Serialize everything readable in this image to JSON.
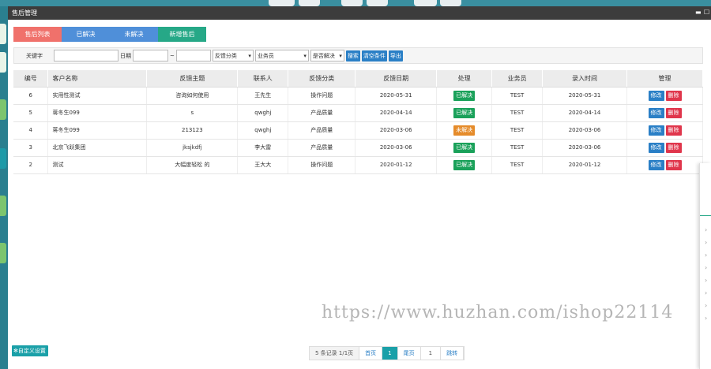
{
  "window": {
    "title": "售后管理"
  },
  "tabs": [
    {
      "label": "售后列表"
    },
    {
      "label": "已解决"
    },
    {
      "label": "未解决"
    },
    {
      "label": "新增售后"
    }
  ],
  "toolbar": {
    "keyword_label": "关键字",
    "date_label": "日期",
    "date_sep": "~",
    "feedback_select": "反馈分类",
    "salesman_select": "业务员",
    "resolved_select": "是否解决",
    "search_btn": "搜索",
    "clear_btn": "清空条件",
    "export_btn": "导出"
  },
  "table": {
    "headers": [
      "编号",
      "客户名称",
      "反馈主题",
      "联系人",
      "反馈分类",
      "反馈日期",
      "处理",
      "业务员",
      "录入时间",
      "管理"
    ],
    "rows": [
      {
        "id": "6",
        "customer": "实用性测试",
        "topic": "咨询如何使用",
        "contact": "王先生",
        "category": "操作问题",
        "date": "2020-05-31",
        "status": "已解决",
        "salesman": "TEST",
        "entry": "2020-05-31"
      },
      {
        "id": "5",
        "customer": "蒋冬生099",
        "topic": "s",
        "contact": "qwghj",
        "category": "产品质量",
        "date": "2020-04-14",
        "status": "已解决",
        "salesman": "TEST",
        "entry": "2020-04-14"
      },
      {
        "id": "4",
        "customer": "蒋冬生099",
        "topic": "213123",
        "contact": "qwghj",
        "category": "产品质量",
        "date": "2020-03-06",
        "status": "未解决",
        "salesman": "TEST",
        "entry": "2020-03-06"
      },
      {
        "id": "3",
        "customer": "北京飞跃集团",
        "topic": "jksjkdfj",
        "contact": "李大雷",
        "category": "产品质量",
        "date": "2020-03-06",
        "status": "已解决",
        "salesman": "TEST",
        "entry": "2020-03-06"
      },
      {
        "id": "2",
        "customer": "测试",
        "topic": "大幅度轻松 的",
        "contact": "王大大",
        "category": "操作问题",
        "date": "2020-01-12",
        "status": "已解决",
        "salesman": "TEST",
        "entry": "2020-01-12"
      }
    ],
    "edit_label": "修改",
    "delete_label": "删除"
  },
  "footer": {
    "custom_settings": "自定义设置",
    "page_info": "5 条记录 1/1页",
    "first": "首页",
    "current": "1",
    "last": "尾页",
    "jump_value": "1",
    "jump": "跳转"
  },
  "watermark": "https://www.huzhan.com/ishop22114",
  "colors": {
    "tab_list": "#f0716b",
    "tab_filter": "#4f8fd9",
    "tab_add": "#26a887",
    "resolved": "#1aa15a",
    "unresolved": "#e58b2a",
    "edit": "#2a7fc6",
    "delete": "#e0364c"
  }
}
